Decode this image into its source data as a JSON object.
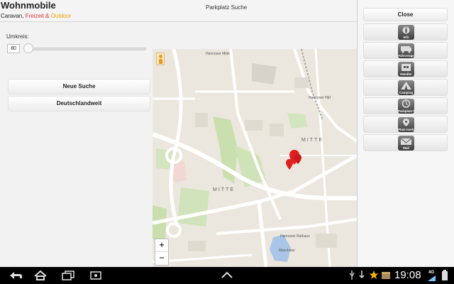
{
  "header": {
    "app_title": "Wohnmobile",
    "subtitle_caravan": "Caravan, ",
    "subtitle_freizeit": "Freizeit & ",
    "subtitle_outdoor": "Outdoor",
    "page_title": "Parkplatz Suche"
  },
  "search": {
    "radius_label": "Umkreis:",
    "radius_value": "80",
    "new_search_label": "Neue Suche",
    "germany_label": "Deutschlandweit"
  },
  "map": {
    "zoom_in": "+",
    "zoom_out": "−",
    "labels": [
      "MITTE",
      "MITTE",
      "Hannover Mitte",
      "Hannover Hbf",
      "Hannover Rathaus",
      "Maschsee"
    ]
  },
  "side_menu": {
    "close_label": "Close",
    "items": [
      {
        "label": "Info",
        "icon": "info-icon"
      },
      {
        "label": "Fahrzeuge",
        "icon": "vehicles-icon"
      },
      {
        "label": "Händler",
        "icon": "dealer-icon"
      },
      {
        "label": "Camping",
        "icon": "camping-icon"
      },
      {
        "label": "Parkplatz-finder",
        "icon": "parking-finder-icon"
      },
      {
        "label": "Platz-merker",
        "icon": "spot-marker-icon"
      },
      {
        "label": "Mail",
        "icon": "mail-icon"
      }
    ]
  },
  "status_bar": {
    "time": "19:08",
    "network": "4G"
  }
}
